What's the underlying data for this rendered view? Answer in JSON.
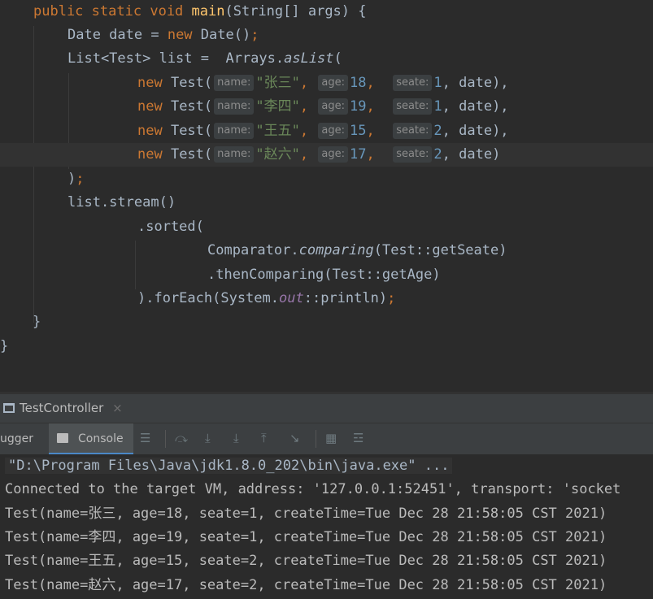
{
  "code": {
    "kw_public": "public",
    "kw_static": "static",
    "kw_void": "void",
    "method_main": "main",
    "main_params": "(String[] args) {",
    "date_decl_a": "Date date = ",
    "kw_new": "new",
    "date_decl_b": " Date()",
    "semicolon": ";",
    "list_decl": "List<Test> list =  Arrays.",
    "as_list": "asList",
    "open_paren": "(",
    "test_ctor": " Test(",
    "hint_name": "name:",
    "hint_age": "age:",
    "hint_seate": "seate:",
    "comma_space": ", ",
    "date_arg_comma": ", date),",
    "date_arg_last": ", date)",
    "rows": [
      {
        "name": "\"张三\"",
        "age": "18",
        "seate": "1"
      },
      {
        "name": "\"李四\"",
        "age": "19",
        "seate": "1"
      },
      {
        "name": "\"王五\"",
        "age": "15",
        "seate": "2"
      },
      {
        "name": "\"赵六\"",
        "age": "17",
        "seate": "2"
      }
    ],
    "close_paren": ")",
    "stream_call": "list.stream()",
    "sorted_call": ".sorted(",
    "comparator_a": "Comparator.",
    "comparing": "comparing",
    "comparator_b": "(Test::getSeate)",
    "then_comparing": ".thenComparing(Test::getAge)",
    "foreach_a": ").forEach(System.",
    "out_field": "out",
    "foreach_b": "::println)",
    "close_brace": "}"
  },
  "run_window": {
    "tab_title": "TestController",
    "close_glyph": "×",
    "debugger_tab": "ugger",
    "console_tab": "Console"
  },
  "console": {
    "lines": [
      "\"D:\\Program Files\\Java\\jdk1.8.0_202\\bin\\java.exe\" ...",
      "Connected to the target VM, address: '127.0.0.1:52451', transport: 'socket",
      "Test(name=张三, age=18, seate=1, createTime=Tue Dec 28 21:58:05 CST 2021)",
      "Test(name=李四, age=19, seate=1, createTime=Tue Dec 28 21:58:05 CST 2021)",
      "Test(name=王五, age=15, seate=2, createTime=Tue Dec 28 21:58:05 CST 2021)",
      "Test(name=赵六, age=17, seate=2, createTime=Tue Dec 28 21:58:05 CST 2021)"
    ]
  },
  "icons": {
    "window": "window-icon",
    "console": "console-icon",
    "menu": "menu-icon",
    "step_over": "step-over-icon",
    "step_into": "step-into-icon",
    "force_step_into": "force-step-into-icon",
    "step_out": "step-out-icon",
    "run_to_cursor": "run-to-cursor-icon",
    "evaluate": "evaluate-icon",
    "settings": "trace-settings-icon"
  },
  "colors": {
    "background": "#2b2b2b",
    "keyword": "#cc7832",
    "method": "#ffc66d",
    "string": "#6a8759",
    "number": "#6897bb",
    "field": "#9876aa",
    "text": "#a9b7c6"
  }
}
